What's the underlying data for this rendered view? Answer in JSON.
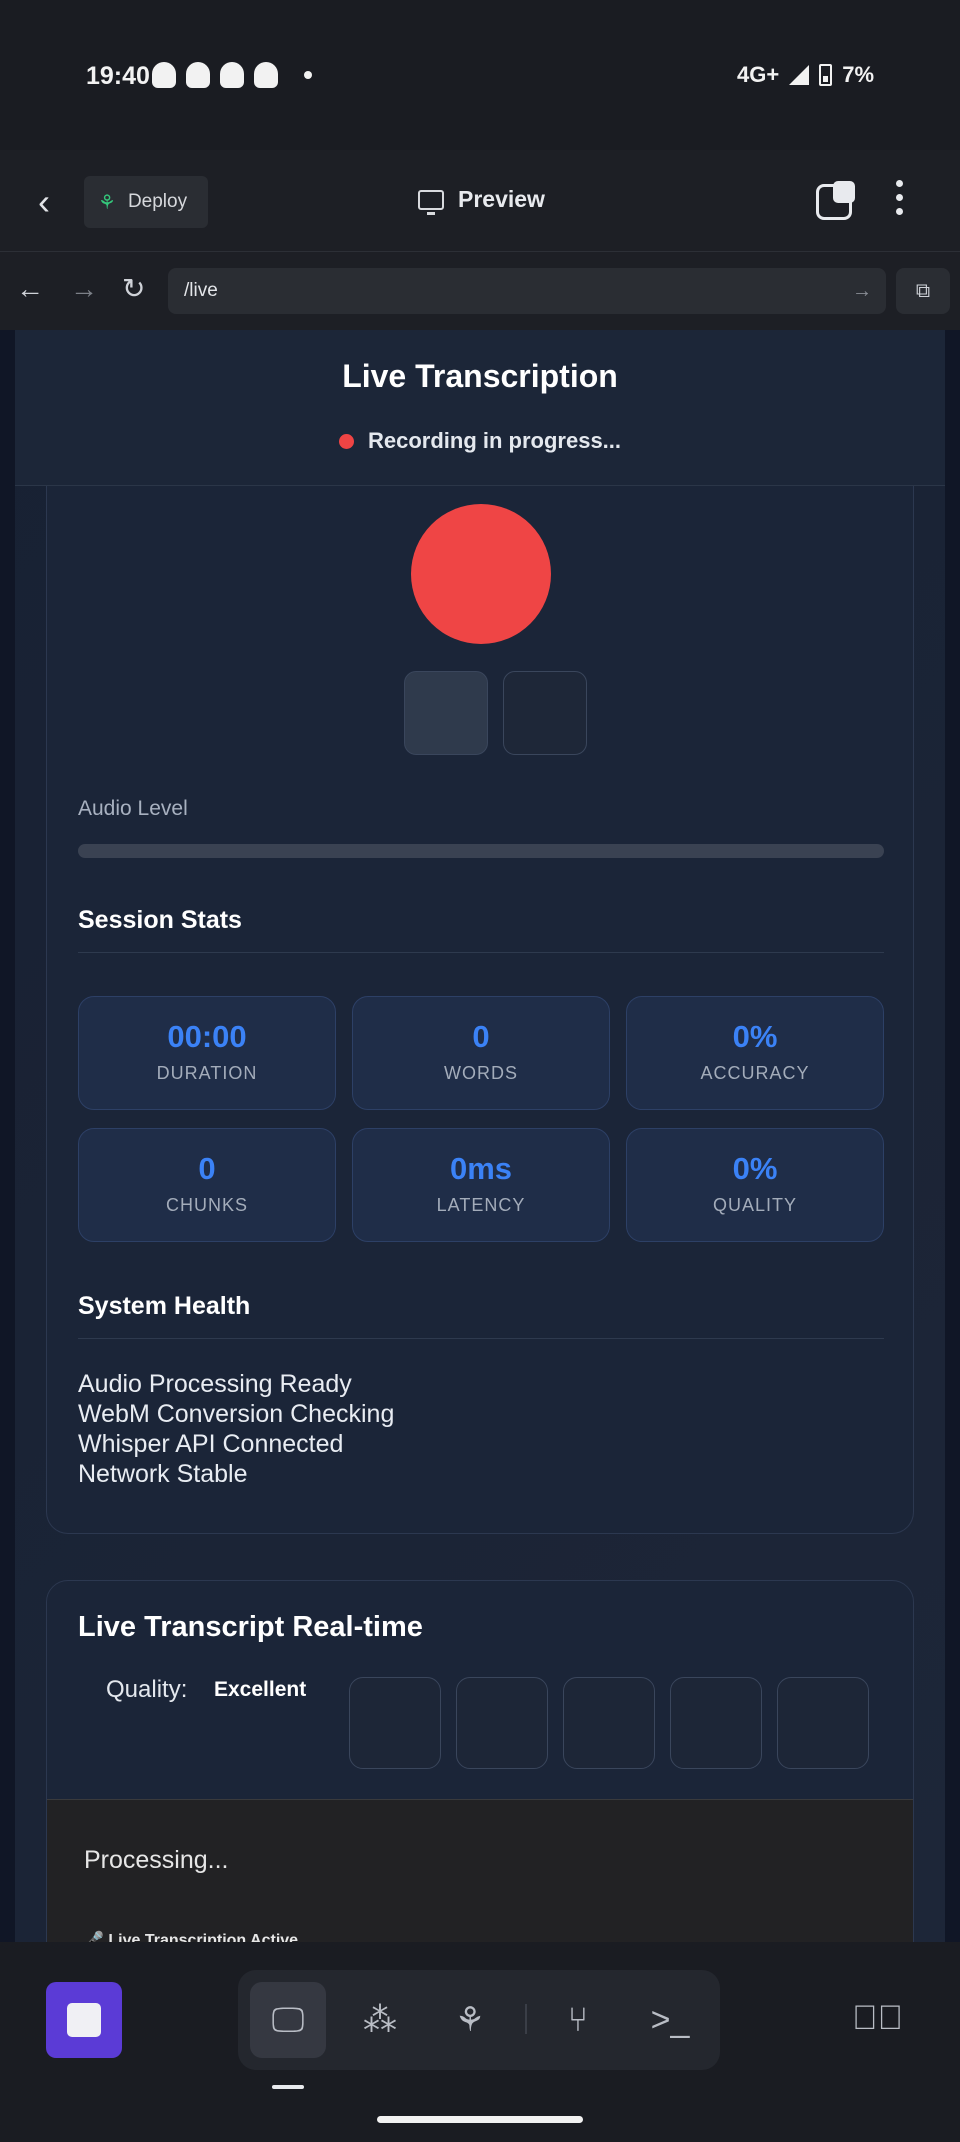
{
  "status_bar": {
    "time": "19:40",
    "network": "4G+",
    "battery": "7%"
  },
  "app_bar": {
    "deploy_label": "Deploy",
    "preview_label": "Preview"
  },
  "url_bar": {
    "url": "/live"
  },
  "page": {
    "title": "Live Transcription",
    "recording_status": "Recording in progress...",
    "audio_level_label": "Audio Level",
    "audio_level": 0,
    "session_stats_title": "Session Stats",
    "stats": [
      {
        "value": "00:00",
        "label": "DURATION"
      },
      {
        "value": "0",
        "label": "WORDS"
      },
      {
        "value": "0%",
        "label": "ACCURACY"
      },
      {
        "value": "0",
        "label": "CHUNKS"
      },
      {
        "value": "0ms",
        "label": "LATENCY"
      },
      {
        "value": "0%",
        "label": "QUALITY"
      }
    ],
    "system_health_title": "System Health",
    "health_items": [
      "Audio Processing Ready",
      "WebM Conversion Checking",
      "Whisper API Connected",
      "Network Stable"
    ],
    "transcript_title": "Live Transcript Real-time",
    "quality_label": "Quality:",
    "quality_value": "Excellent",
    "processing_text": "Processing...",
    "processing_sub": "🎤 Live Transcription Active"
  },
  "colors": {
    "accent": "#3b82f6",
    "record": "#ef4444",
    "stop_button": "#5b3bd6"
  }
}
